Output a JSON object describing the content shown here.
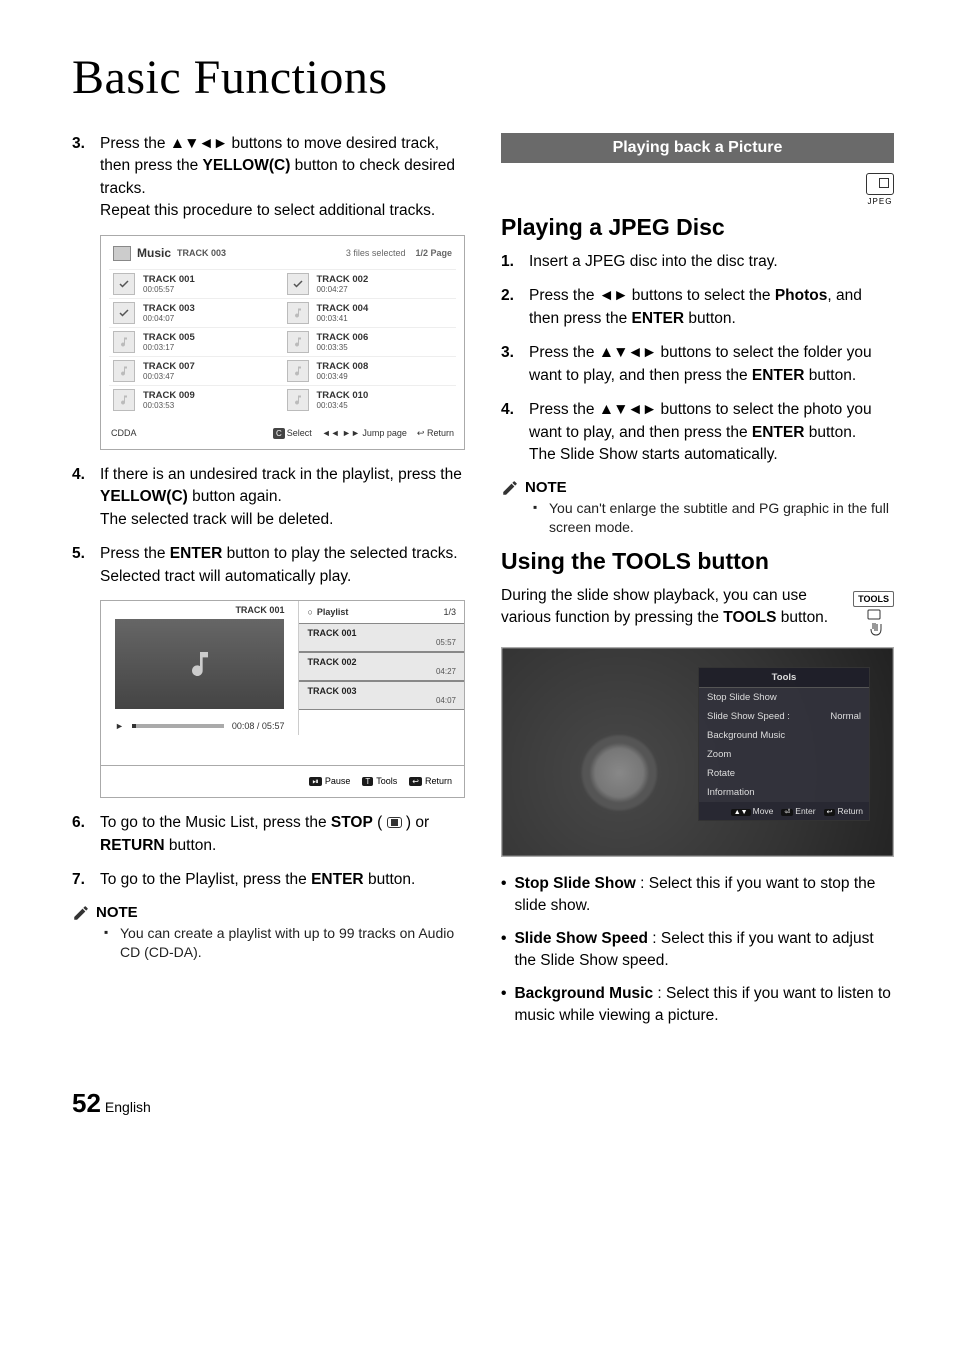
{
  "title": "Basic Functions",
  "left": {
    "step3": {
      "num": "3.",
      "pre": "Press the ",
      "arrows": "▲▼◄►",
      "mid": " buttons to move desired track, then press the ",
      "yellow": "YELLOW(C)",
      "post": " button to check desired tracks.",
      "line2": "Repeat this procedure to select additional tracks."
    },
    "music_header": {
      "label": "Music",
      "sub": "TRACK 003",
      "meta1": "3 files selected",
      "meta2": "1/2 Page"
    },
    "tracks": [
      {
        "name": "TRACK 001",
        "dur": "00:05:57",
        "checked": true
      },
      {
        "name": "TRACK 002",
        "dur": "00:04:27",
        "checked": true
      },
      {
        "name": "TRACK 003",
        "dur": "00:04:07",
        "checked": true
      },
      {
        "name": "TRACK 004",
        "dur": "00:03:41",
        "checked": false
      },
      {
        "name": "TRACK 005",
        "dur": "00:03:17",
        "checked": false
      },
      {
        "name": "TRACK 006",
        "dur": "00:03:35",
        "checked": false
      },
      {
        "name": "TRACK 007",
        "dur": "00:03:47",
        "checked": false
      },
      {
        "name": "TRACK 008",
        "dur": "00:03:49",
        "checked": false
      },
      {
        "name": "TRACK 009",
        "dur": "00:03:53",
        "checked": false
      },
      {
        "name": "TRACK 010",
        "dur": "00:03:45",
        "checked": false
      }
    ],
    "music_footer": {
      "left": "CDDA",
      "c": "C",
      "select": "Select",
      "jump_sym": "◄◄ ►►",
      "jump": "Jump page",
      "ret_sym": "↩",
      "ret": "Return"
    },
    "step4": {
      "num": "4.",
      "l1": "If there is an undesired track in the playlist, press the ",
      "yellow": "YELLOW(C)",
      "l1b": " button again.",
      "l2": "The selected track will be deleted."
    },
    "step5": {
      "num": "5.",
      "l1": "Press the ",
      "enter": "ENTER",
      "l1b": " button to play the selected tracks.",
      "l2": "Selected tract will automatically play."
    },
    "playlist": {
      "head_icon": "○",
      "head_label": "Playlist",
      "page": "1/3",
      "now": "TRACK 001",
      "items": [
        {
          "name": "TRACK 001",
          "dur": "05:57"
        },
        {
          "name": "TRACK 002",
          "dur": "04:27"
        },
        {
          "name": "TRACK 003",
          "dur": "04:07"
        }
      ],
      "play_sym": "►",
      "progress": "00:08 / 05:57",
      "foot": {
        "pause_k": "⏯",
        "pause": "Pause",
        "tools_k": "T",
        "tools": "Tools",
        "ret_k": "↩",
        "ret": "Return"
      }
    },
    "step6": {
      "num": "6.",
      "l1a": "To go to the Music List, press the ",
      "stop": "STOP",
      "l1b": " ( ",
      "l1c": " ) or ",
      "ret": "RETURN",
      "l1d": " button."
    },
    "step7": {
      "num": "7.",
      "l1a": "To go to the Playlist, press the ",
      "enter": "ENTER",
      "l1b": " button."
    },
    "note_label": "NOTE",
    "note_item": "You can create a playlist with up to 99 tracks on Audio CD (CD-DA)."
  },
  "right": {
    "section_title": "Playing back a Picture",
    "jpeg_label": "JPEG",
    "heading1": "Playing a JPEG Disc",
    "step1": {
      "num": "1.",
      "text": "Insert a JPEG disc into the disc tray."
    },
    "step2": {
      "num": "2.",
      "pre": "Press the ",
      "arrows": "◄►",
      "mid": " buttons to select the ",
      "photos": "Photos",
      "mid2": ", and then press the ",
      "enter": "ENTER",
      "post": " button."
    },
    "step3": {
      "num": "3.",
      "pre": "Press the ",
      "arrows": "▲▼◄►",
      "mid": " buttons to select the folder you want to play, and then press the ",
      "enter": "ENTER",
      "post": " button."
    },
    "step4": {
      "num": "4.",
      "pre": "Press the ",
      "arrows": "▲▼◄►",
      "mid": " buttons to select the photo you want to play, and then press the ",
      "enter": "ENTER",
      "post": " button.",
      "l2": "The Slide Show starts automatically."
    },
    "note_label": "NOTE",
    "note_item": "You can't enlarge the subtitle and PG graphic in the full screen mode.",
    "heading2": "Using the TOOLS button",
    "tools_btn_label": "TOOLS",
    "tools_intro_pre": "During the slide show playback, you can use various function by pressing the ",
    "tools_intro_bold": "TOOLS",
    "tools_intro_post": " button.",
    "tools_panel": {
      "title": "Tools",
      "items": [
        "Stop Slide Show",
        "Slide Show Speed  :",
        "Background Music",
        "Zoom",
        "Rotate",
        "Information"
      ],
      "speed_val": "Normal",
      "foot": {
        "move_k": "▲▼",
        "move": "Move",
        "enter_k": "⏎",
        "enter": "Enter",
        "ret_k": "↩",
        "ret": "Return"
      }
    },
    "bullets": [
      {
        "b": "Stop Slide Show",
        "t": " : Select this if you want to stop the slide show."
      },
      {
        "b": "Slide Show Speed",
        "t": " : Select this if you want to adjust the Slide Show speed."
      },
      {
        "b": "Background Music",
        "t": " : Select this if you want to listen to music while viewing a picture."
      }
    ]
  },
  "footer": {
    "page": "52",
    "lang": "English"
  }
}
